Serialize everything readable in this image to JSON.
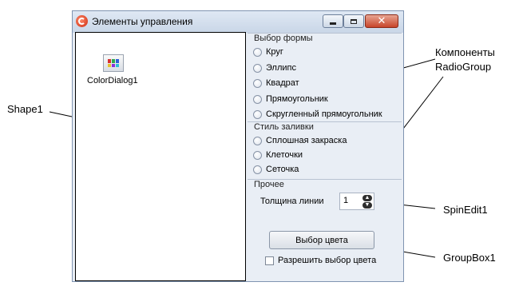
{
  "window": {
    "title": "Элементы управления",
    "icon": "app-icon",
    "controls": [
      "minimize-icon",
      "maximize-icon",
      "close-icon"
    ]
  },
  "shape_panel": {
    "component_label": "ColorDialog1",
    "component_icon": "color-dialog-icon"
  },
  "shape_group": {
    "caption": "Выбор формы",
    "options": [
      "Круг",
      "Эллипс",
      "Квадрат",
      "Прямоугольник",
      "Скругленный прямоугольник"
    ]
  },
  "fill_group": {
    "caption": "Стиль заливки",
    "options": [
      "Сплошная закраска",
      "Клеточки",
      "Сеточка"
    ]
  },
  "misc_group": {
    "caption": "Прочее",
    "line_width_label": "Толщина линии",
    "line_width_value": "1",
    "pick_color_button": "Выбор цвета",
    "allow_color_checkbox": "Разрешить выбор цвета",
    "allow_color_checked": false
  },
  "annotations": {
    "radiogroup_line1": "Компоненты",
    "radiogroup_line2": "RadioGroup",
    "shape": "Shape1",
    "spinedit": "SpinEdit1",
    "groupbox": "GroupBox1"
  },
  "colors": {
    "titlebar": "#c9d6e7",
    "window_bg": "#e9eef5",
    "close_button": "#c8442a"
  }
}
